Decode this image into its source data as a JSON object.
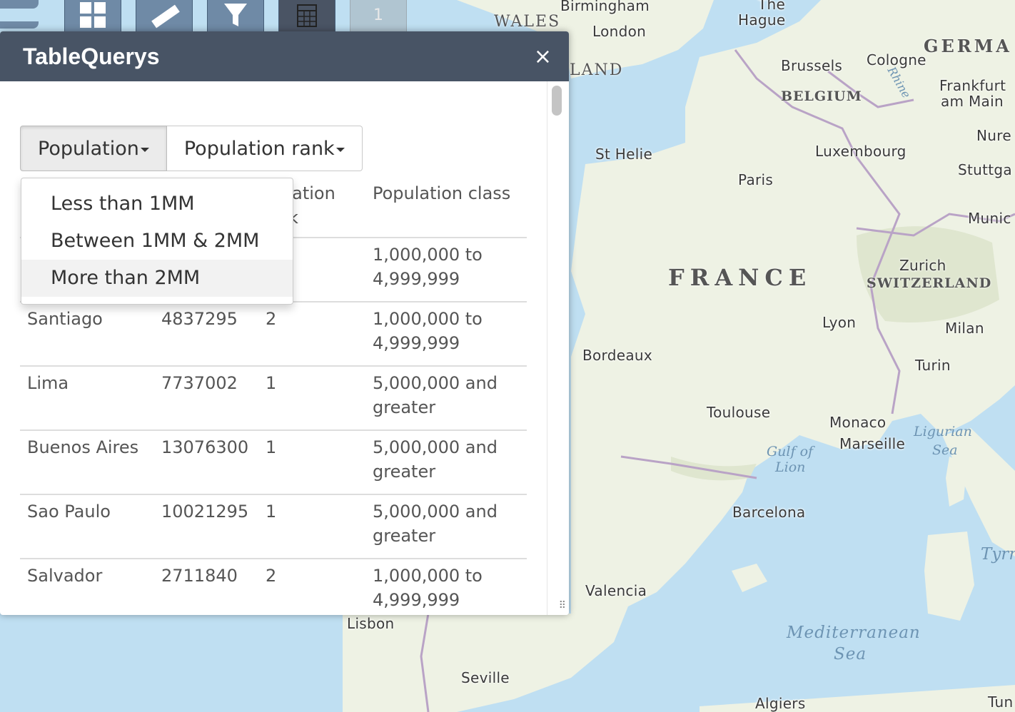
{
  "panel": {
    "title": "TableQuerys",
    "close_glyph": "×",
    "filters": [
      {
        "label": "Population",
        "active": true
      },
      {
        "label": "Population rank",
        "active": false
      }
    ],
    "dropdown_items": [
      {
        "label": "Less than 1MM",
        "highlighted": false
      },
      {
        "label": "Between 1MM & 2MM",
        "highlighted": false
      },
      {
        "label": "More than 2MM",
        "highlighted": true
      }
    ],
    "columns": [
      "Population rank",
      "Population class"
    ],
    "columns_partial": [
      "pulation",
      "k"
    ],
    "rows": [
      {
        "name": "",
        "population": "",
        "rank": "",
        "class": "1,000,000 to 4,999,999"
      },
      {
        "name": "Santiago",
        "population": "4837295",
        "rank": "2",
        "class": "1,000,000 to 4,999,999"
      },
      {
        "name": "Lima",
        "population": "7737002",
        "rank": "1",
        "class": "5,000,000 and greater"
      },
      {
        "name": "Buenos Aires",
        "population": "13076300",
        "rank": "1",
        "class": "5,000,000 and greater"
      },
      {
        "name": "Sao Paulo",
        "population": "10021295",
        "rank": "1",
        "class": "5,000,000 and greater"
      },
      {
        "name": "Salvador",
        "population": "2711840",
        "rank": "2",
        "class": "1,000,000 to 4,999,999"
      }
    ]
  },
  "toolbar": {
    "icons": [
      "grid-icon",
      "ruler-icon",
      "filter-icon",
      "table-icon"
    ],
    "badge": "1"
  },
  "map": {
    "countries": [
      "FRANCE",
      "SWITZERLAND",
      "BELGIUM",
      "GERMA",
      "WALES",
      "LAND"
    ],
    "cities": [
      "Birmingham",
      "London",
      "The",
      "Hague",
      "Brussels",
      "Cologne",
      "Frankfurt",
      "am Main",
      "Nure",
      "Stuttga",
      "Munic",
      "Luxembourg",
      "St Helie",
      "Paris",
      "Zurich",
      "Lyon",
      "Milan",
      "Turin",
      "Bordeaux",
      "Toulouse",
      "Monaco",
      "Marseille",
      "Barcelona",
      "Valencia",
      "Lisbon",
      "Seville",
      "Algiers",
      "Tun",
      "Rhine"
    ],
    "seas": [
      "Gulf of",
      "Lion",
      "Ligurian",
      "Sea",
      "Mediterranean",
      "Sea",
      "Tyrr"
    ]
  },
  "colors": {
    "header": "#485465",
    "land": "#eef2e4",
    "water": "#bfdff2",
    "toolbar": "#6f8aa6"
  }
}
